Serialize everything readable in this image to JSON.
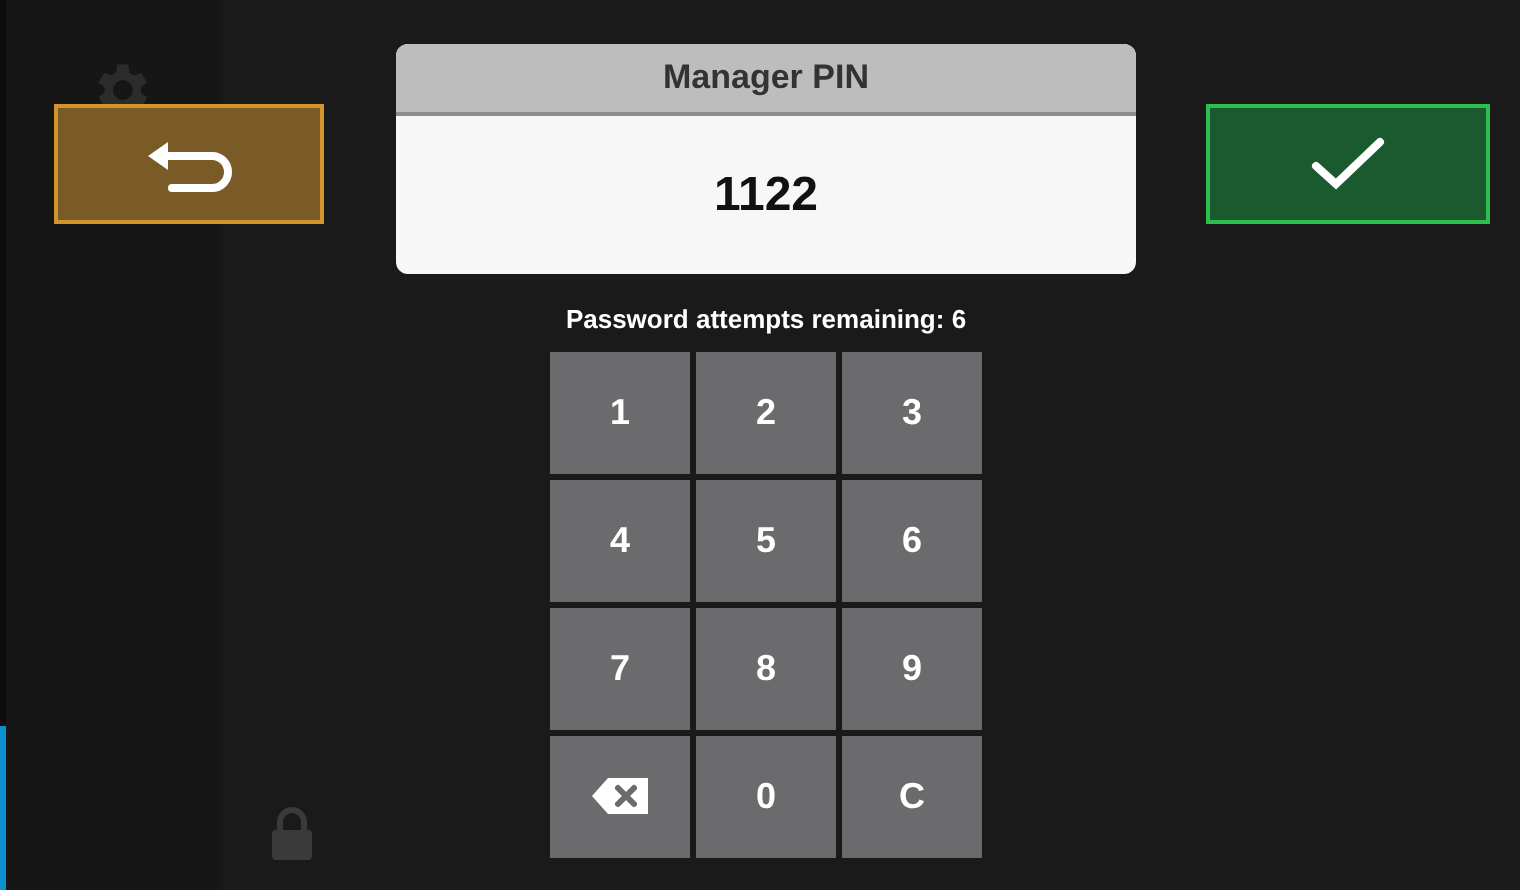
{
  "dialog": {
    "title": "Manager PIN",
    "value": "1122",
    "attempts": "Password attempts remaining: 6"
  },
  "keys": [
    {
      "kind": "digit",
      "label": "1"
    },
    {
      "kind": "digit",
      "label": "2"
    },
    {
      "kind": "digit",
      "label": "3"
    },
    {
      "kind": "digit",
      "label": "4"
    },
    {
      "kind": "digit",
      "label": "5"
    },
    {
      "kind": "digit",
      "label": "6"
    },
    {
      "kind": "digit",
      "label": "7"
    },
    {
      "kind": "digit",
      "label": "8"
    },
    {
      "kind": "digit",
      "label": "9"
    },
    {
      "kind": "backspace"
    },
    {
      "kind": "digit",
      "label": "0"
    },
    {
      "kind": "digit",
      "label": "C"
    }
  ]
}
